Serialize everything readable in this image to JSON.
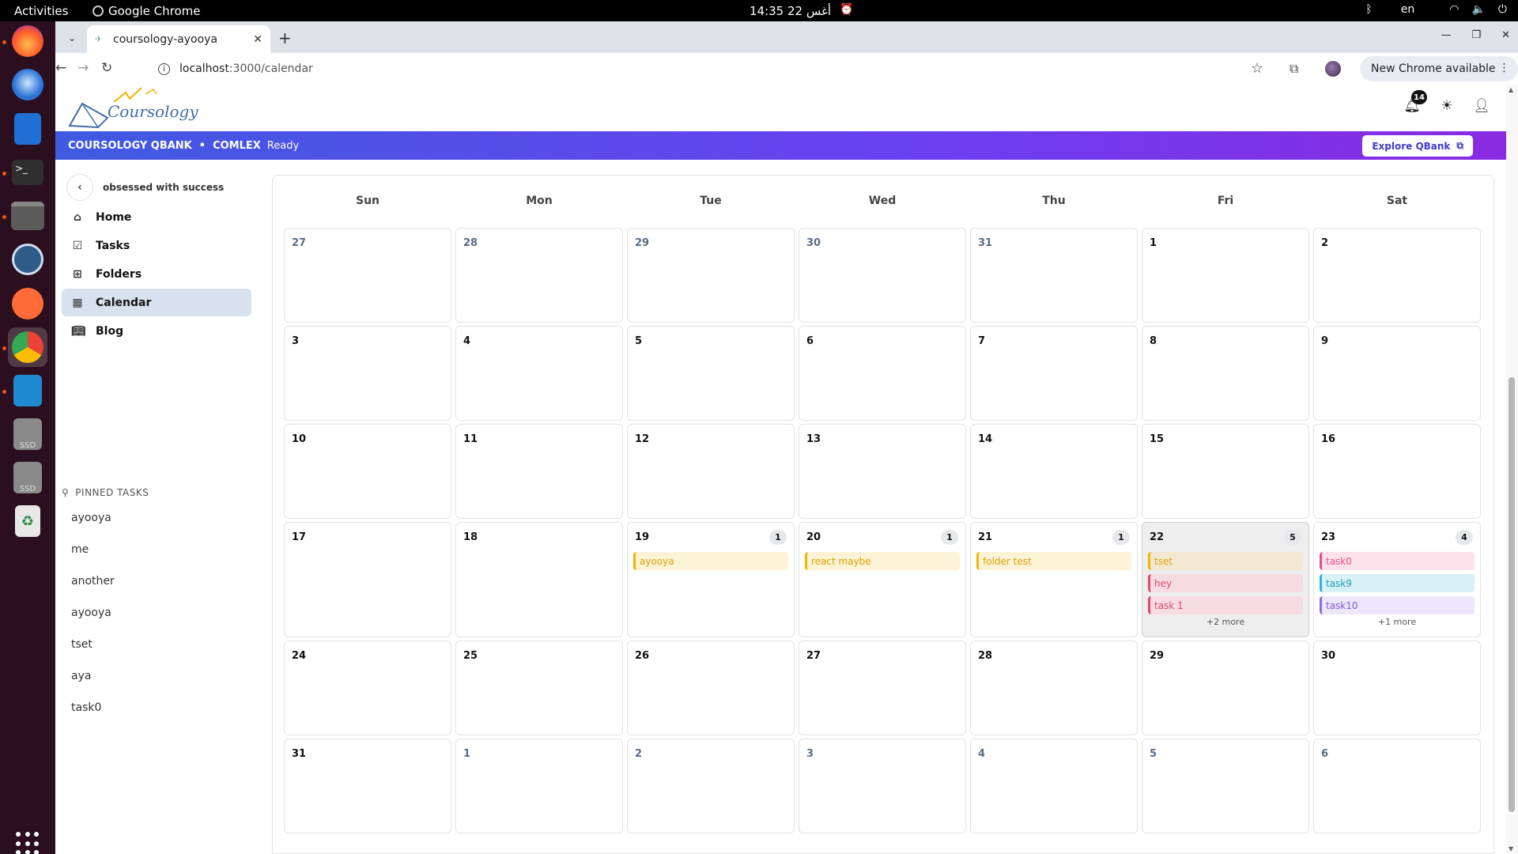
{
  "system": {
    "activities": "Activities",
    "app_name": "Google Chrome",
    "clock": "14:35  22 أغس",
    "lang": "en"
  },
  "browser": {
    "tab_title": "coursology-ayooya",
    "url_host": "localhost",
    "url_path": ":3000/calendar",
    "update_label": "New Chrome available"
  },
  "header": {
    "logo_text": "Coursology",
    "notif_count": "14"
  },
  "promo": {
    "brand": "COURSOLOGY QBANK",
    "sep": "•",
    "product": "COMLEX",
    "status": "Ready",
    "cta": "Explore QBank"
  },
  "sidebar": {
    "subtitle": "obsessed with success",
    "nav": [
      {
        "label": "Home",
        "icon": "home-icon"
      },
      {
        "label": "Tasks",
        "icon": "check-square-icon"
      },
      {
        "label": "Folders",
        "icon": "folder-tree-icon"
      },
      {
        "label": "Calendar",
        "icon": "calendar-icon",
        "active": true
      },
      {
        "label": "Blog",
        "icon": "book-icon"
      }
    ],
    "pinned_title": "PINNED TASKS",
    "pinned": [
      "ayooya",
      "me",
      "another",
      "ayooya",
      "tset",
      "aya",
      "task0"
    ]
  },
  "calendar": {
    "days": [
      "Sun",
      "Mon",
      "Tue",
      "Wed",
      "Thu",
      "Fri",
      "Sat"
    ],
    "weeks": [
      [
        {
          "n": "27",
          "other": true
        },
        {
          "n": "28",
          "other": true
        },
        {
          "n": "29",
          "other": true
        },
        {
          "n": "30",
          "other": true
        },
        {
          "n": "31",
          "other": true
        },
        {
          "n": "1"
        },
        {
          "n": "2"
        }
      ],
      [
        {
          "n": "3"
        },
        {
          "n": "4"
        },
        {
          "n": "5"
        },
        {
          "n": "6"
        },
        {
          "n": "7"
        },
        {
          "n": "8"
        },
        {
          "n": "9"
        }
      ],
      [
        {
          "n": "10"
        },
        {
          "n": "11"
        },
        {
          "n": "12"
        },
        {
          "n": "13"
        },
        {
          "n": "14"
        },
        {
          "n": "15"
        },
        {
          "n": "16"
        }
      ],
      [
        {
          "n": "17"
        },
        {
          "n": "18"
        },
        {
          "n": "19",
          "count": "1",
          "events": [
            {
              "t": "ayooya",
              "c": "yellow"
            }
          ]
        },
        {
          "n": "20",
          "count": "1",
          "events": [
            {
              "t": "react maybe",
              "c": "yellow"
            }
          ]
        },
        {
          "n": "21",
          "count": "1",
          "events": [
            {
              "t": "folder test",
              "c": "yellow"
            }
          ]
        },
        {
          "n": "22",
          "count": "5",
          "today": true,
          "events": [
            {
              "t": "tset",
              "c": "tan"
            },
            {
              "t": "hey",
              "c": "pink"
            },
            {
              "t": "task 1",
              "c": "pink"
            }
          ],
          "more": "+2 more"
        },
        {
          "n": "23",
          "count": "4",
          "events": [
            {
              "t": "task0",
              "c": "pinkl"
            },
            {
              "t": "task9",
              "c": "cyan"
            },
            {
              "t": "task10",
              "c": "lav"
            }
          ],
          "more": "+1 more"
        }
      ],
      [
        {
          "n": "24"
        },
        {
          "n": "25"
        },
        {
          "n": "26"
        },
        {
          "n": "27"
        },
        {
          "n": "28"
        },
        {
          "n": "29"
        },
        {
          "n": "30"
        }
      ],
      [
        {
          "n": "31"
        },
        {
          "n": "1",
          "other": true
        },
        {
          "n": "2",
          "other": true
        },
        {
          "n": "3",
          "other": true
        },
        {
          "n": "4",
          "other": true
        },
        {
          "n": "5",
          "other": true
        },
        {
          "n": "6",
          "other": true
        }
      ]
    ]
  }
}
